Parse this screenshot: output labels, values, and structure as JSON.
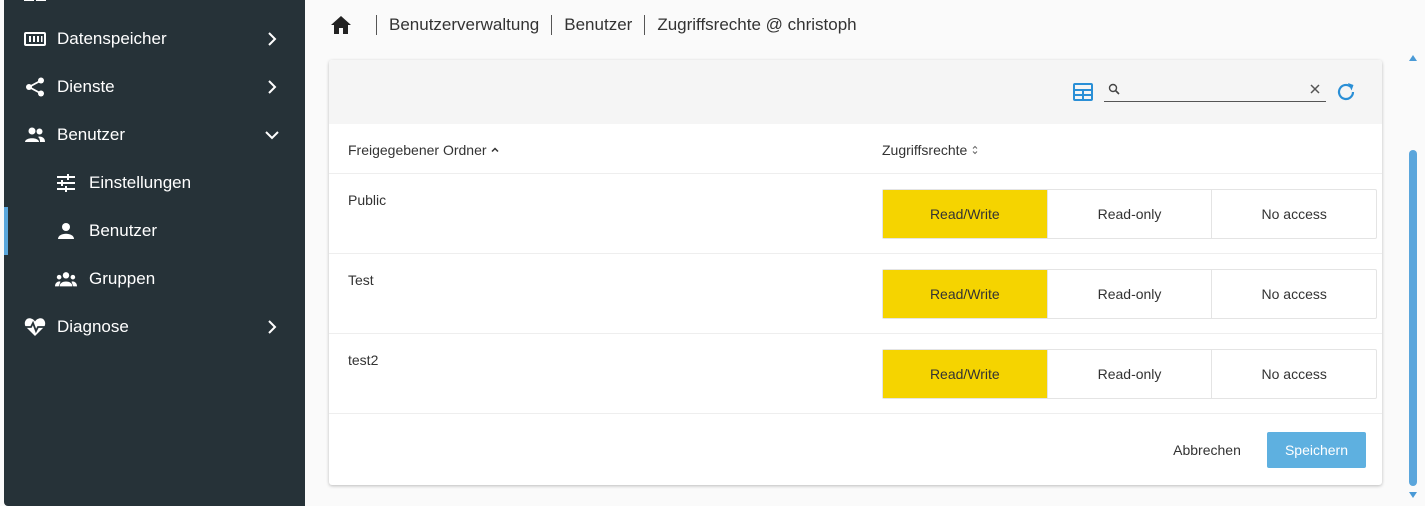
{
  "sidebar": {
    "items": [
      {
        "label": "Datenspeicher",
        "icon": "storage-icon"
      },
      {
        "label": "Dienste",
        "icon": "share-icon"
      },
      {
        "label": "Benutzer",
        "icon": "users-icon",
        "expanded": true
      },
      {
        "label": "Einstellungen",
        "icon": "tune-icon"
      },
      {
        "label": "Benutzer",
        "icon": "user-icon",
        "active": true
      },
      {
        "label": "Gruppen",
        "icon": "groups-icon"
      },
      {
        "label": "Diagnose",
        "icon": "heart-pulse-icon"
      }
    ]
  },
  "breadcrumb": {
    "items": [
      "Benutzerverwaltung",
      "Benutzer",
      "Zugriffsrechte @ christoph"
    ]
  },
  "search": {
    "value": "",
    "placeholder": ""
  },
  "table": {
    "columns": [
      "Freigegebener Ordner",
      "Zugriffsrechte"
    ],
    "options": [
      "Read/Write",
      "Read-only",
      "No access"
    ],
    "rows": [
      {
        "folder": "Public",
        "selected": "Read/Write"
      },
      {
        "folder": "Test",
        "selected": "Read/Write"
      },
      {
        "folder": "test2",
        "selected": "Read/Write"
      }
    ]
  },
  "footer": {
    "cancel_label": "Abbrechen",
    "save_label": "Speichern"
  },
  "colors": {
    "sidebar_bg": "#263238",
    "selected": "#f5d400",
    "accent": "#5eb0e0"
  }
}
